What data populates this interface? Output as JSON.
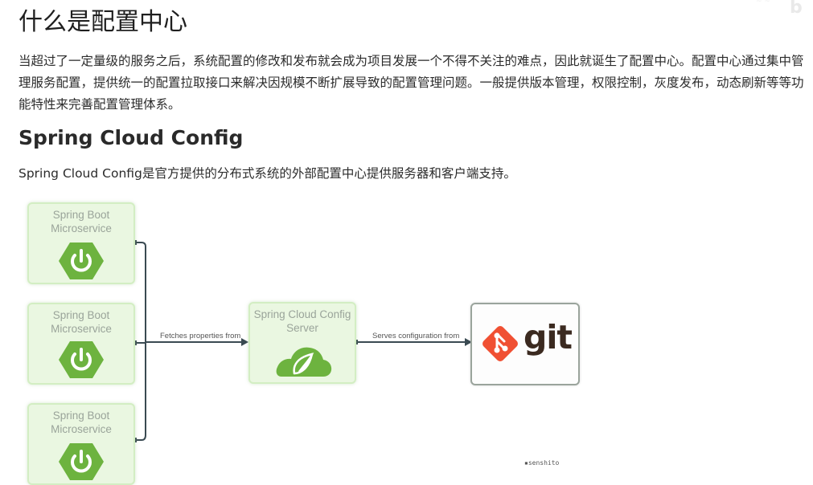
{
  "heading_config_center": "什么是配置中心",
  "intro_paragraph": "当超过了一定量级的服务之后，系统配置的修改和发布就会成为项目发展一个不得不关注的难点，因此就诞生了配置中心。配置中心通过集中管理服务配置，提供统一的配置拉取接口来解决因规模不断扩展导致的配置管理问题。一般提供版本管理，权限控制，灰度发布，动态刷新等等功能特性来完善配置管理体系。",
  "heading_spring_cloud_config": "Spring Cloud Config",
  "spring_cloud_config_paragraph": "Spring Cloud Config是官方提供的分布式系统的外部配置中心提供服务器和客户端支持。",
  "diagram": {
    "microservices": [
      {
        "line1": "Spring Boot",
        "line2": "Microservice"
      },
      {
        "line1": "Spring Boot",
        "line2": "Microservice"
      },
      {
        "line1": "Spring Boot",
        "line2": "Microservice"
      }
    ],
    "server": {
      "line1": "Spring Cloud Config",
      "line2": "Server"
    },
    "fetch_label": "Fetches properties from",
    "serve_label": "Serves configuration from",
    "git_label": "git",
    "signature": "▪senshito"
  },
  "colors": {
    "box_fill": "#eaf7e1",
    "spring_green": "#6db33f",
    "git_orange": "#f05033",
    "git_text": "#3b2a20"
  }
}
